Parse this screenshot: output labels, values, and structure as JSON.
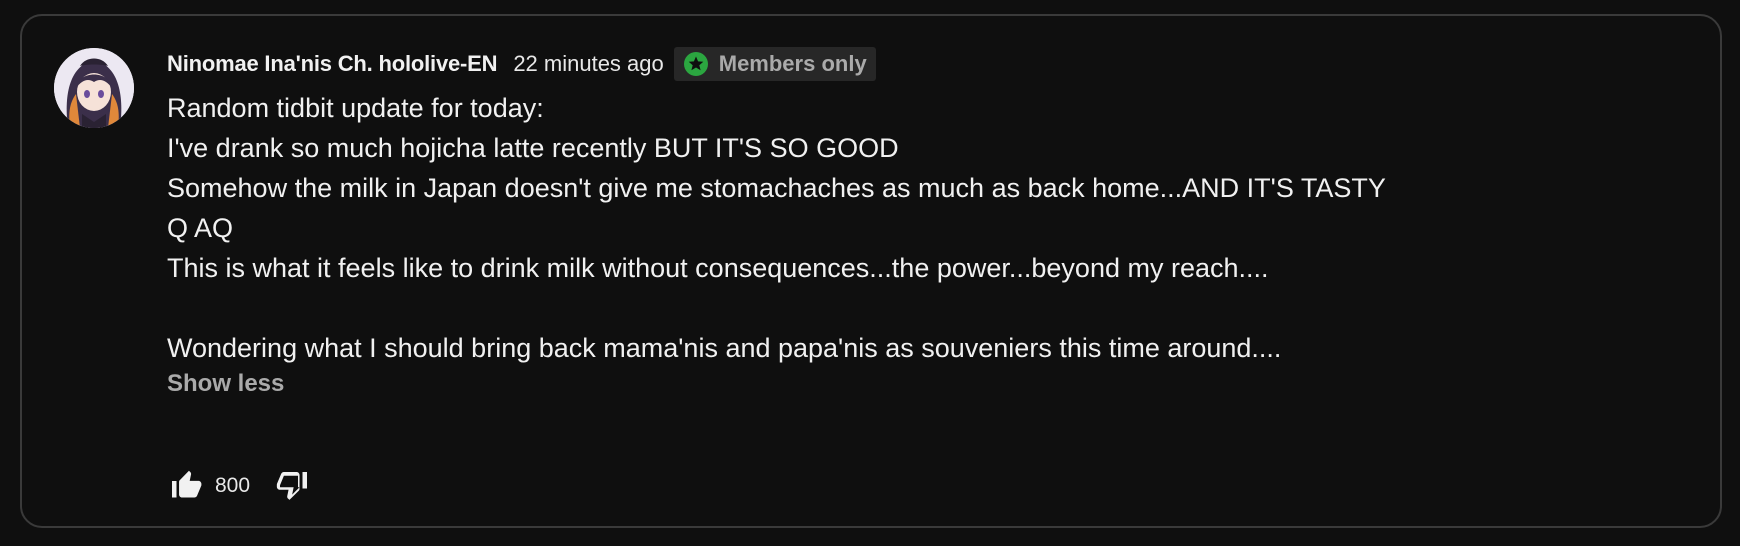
{
  "comment": {
    "author": "Ninomae Ina'nis Ch. hololive-EN",
    "timestamp": "22 minutes ago",
    "badge": {
      "icon": "star-icon",
      "label": "Members only",
      "icon_color": "#2ba640"
    },
    "lines": [
      "Random tidbit update for today:",
      "I've drank so much hojicha latte recently BUT IT'S SO GOOD",
      "Somehow the milk in Japan doesn't give me stomachaches as much as back home...AND IT'S TASTY",
      "Q AQ",
      "This is what it feels like to drink milk without consequences...the power...beyond my reach....",
      "",
      "Wondering what I should bring back mama'nis and papa'nis as souveniers this time around...."
    ],
    "show_less": "Show less",
    "like_count": "800",
    "icons": {
      "like": "thumbs-up-icon",
      "dislike": "thumbs-down-icon",
      "avatar": "avatar"
    }
  },
  "colors": {
    "background": "#0f0f0f",
    "border": "#3a3a3a",
    "text_primary": "#f1f1f1",
    "text_secondary": "#aaaaaa",
    "badge_bg": "#272727"
  }
}
